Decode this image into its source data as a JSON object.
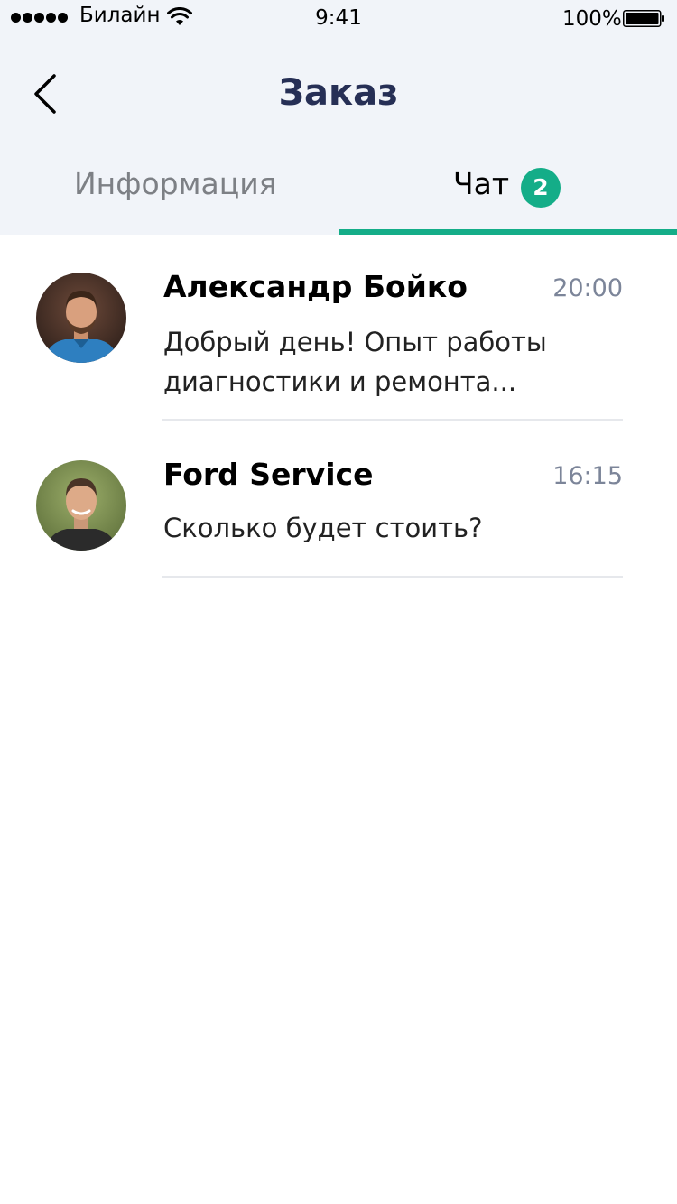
{
  "status_bar": {
    "carrier": "Билайн",
    "time": "9:41",
    "battery": "100%"
  },
  "nav": {
    "title": "Заказ",
    "back_icon": "chevron-left-icon"
  },
  "tabs": [
    {
      "label": "Информация",
      "active": false
    },
    {
      "label": "Чат",
      "active": true,
      "badge": "2"
    }
  ],
  "chats": [
    {
      "name": "Александр Бойко",
      "time": "20:00",
      "message": "Добрый день! Опыт работы диагностики и ремонта..."
    },
    {
      "name": "Ford Service",
      "time": "16:15",
      "message": "Сколько будет стоить?"
    }
  ],
  "colors": {
    "accent": "#14ad88",
    "title": "#262f55",
    "header_bg": "#f1f4f9",
    "time": "#7c8599"
  }
}
